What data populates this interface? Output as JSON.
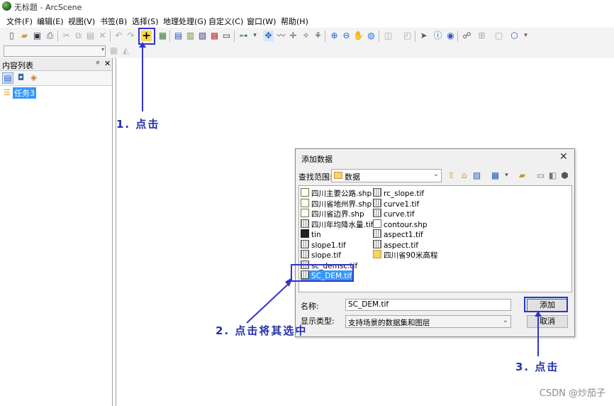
{
  "window": {
    "title": "无标题 - ArcScene"
  },
  "menubar": [
    "文件(F)",
    "编辑(E)",
    "视图(V)",
    "书签(B)",
    "选择(S)",
    "地理处理(G)",
    "自定义(C)",
    "窗口(W)",
    "帮助(H)"
  ],
  "toc": {
    "title": "内容列表",
    "pin": "ᵖ",
    "close": "✕",
    "layer": "任务3"
  },
  "dialog": {
    "title": "添加数据",
    "close": "✕",
    "look_in_label": "查找范围:",
    "look_in_value": "数据",
    "files_col1": [
      "四川主要公路.shp",
      "四川省地州界.shp",
      "四川省边界.shp",
      "四川年均降水量.tif",
      "tin",
      "slope1.tif",
      "slope.tif",
      "sc_demsc.tif",
      "SC_DEM.tif"
    ],
    "files_col2": [
      "rc_slope.tif",
      "curve1.tif",
      "curve.tif",
      "contour.shp",
      "aspect1.tif",
      "aspect.tif",
      "四川省90米高程"
    ],
    "name_label": "名称:",
    "name_value": "SC_DEM.tif",
    "type_label": "显示类型:",
    "type_value": "支持场景的数据集和图层",
    "add_button": "添加",
    "cancel_button": "取消"
  },
  "annotations": {
    "step1": "1. 点击",
    "step2": "2. 点击将其选中",
    "step3": "3. 点击"
  },
  "watermark": "CSDN @炒茄子",
  "colors": {
    "annotation": "#2530a9",
    "selection": "#3399ff"
  }
}
